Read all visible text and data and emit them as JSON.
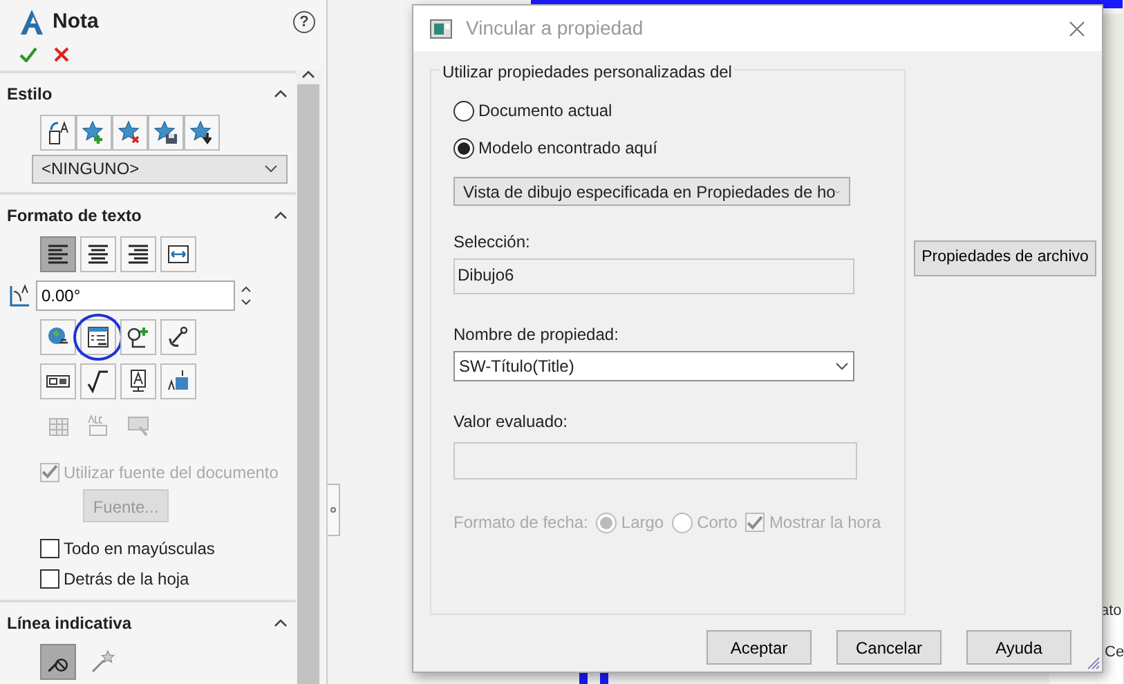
{
  "panel": {
    "title": "Nota",
    "help": "?",
    "sections": [
      {
        "kind": "style",
        "title": "Estilo",
        "expanded": true,
        "tools": [
          {
            "kind": "text-style"
          },
          {
            "kind": "star-add"
          },
          {
            "kind": "star-delete"
          },
          {
            "kind": "star-save"
          },
          {
            "kind": "star-load"
          }
        ],
        "select": "<NINGUNO>"
      },
      {
        "kind": "format",
        "title": "Formato de texto",
        "expanded": true,
        "align": [
          {
            "kind": "align-left",
            "selected": true
          },
          {
            "kind": "align-center",
            "selected": false
          },
          {
            "kind": "align-right",
            "selected": false
          },
          {
            "kind": "fit-text",
            "selected": false
          }
        ],
        "angle": "0.00°",
        "tool_rows": [
          [
            {
              "kind": "globe-link",
              "disabled": false,
              "circled": false
            },
            {
              "kind": "property-link",
              "disabled": false,
              "circled": true
            },
            {
              "kind": "balloon-add",
              "disabled": false,
              "circled": false
            },
            {
              "kind": "anchor",
              "disabled": false,
              "circled": false
            }
          ],
          [
            {
              "kind": "frame",
              "disabled": false,
              "circled": false
            },
            {
              "kind": "sqrt",
              "disabled": false,
              "circled": false
            },
            {
              "kind": "text-box",
              "disabled": false,
              "circled": false
            },
            {
              "kind": "stack",
              "disabled": false,
              "circled": false
            }
          ],
          [
            {
              "kind": "table",
              "disabled": true,
              "circled": false
            },
            {
              "kind": "abc-link",
              "disabled": true,
              "circled": false
            },
            {
              "kind": "hatch",
              "disabled": true,
              "circled": false
            }
          ]
        ],
        "doc_font": {
          "label": "Utilizar fuente del documento",
          "checked": true,
          "disabled": true
        },
        "font_button": {
          "label": "Fuente...",
          "disabled": true
        },
        "checks": [
          {
            "label": "Todo en mayúsculas",
            "checked": false
          },
          {
            "label": "Detrás de la hoja",
            "checked": false
          }
        ]
      },
      {
        "kind": "leader",
        "title": "Línea indicativa",
        "expanded": true,
        "leaders": [
          {
            "kind": "no-leader",
            "selected": true
          },
          {
            "kind": "star-leader",
            "selected": false
          }
        ]
      }
    ]
  },
  "background_texts": [
    "ato",
    "Ce"
  ],
  "dialog": {
    "title": "Vincular a propiedad",
    "group_title": "Utilizar propiedades personalizadas del",
    "sources": [
      {
        "label": "Documento actual",
        "selected": false
      },
      {
        "label": "Modelo encontrado aquí",
        "selected": true
      }
    ],
    "model_select": "Vista de dibujo especificada en Propiedades de ho",
    "selection_label": "Selección:",
    "selection_value": "Dibujo6",
    "file_props_button": "Propiedades de archivo",
    "property_label": "Nombre de propiedad:",
    "property_value": "SW-Título(Title)",
    "evaluated_label": "Valor evaluado:",
    "date": {
      "label": "Formato de fecha:",
      "disabled": true,
      "options": [
        {
          "label": "Largo",
          "selected": true
        },
        {
          "label": "Corto",
          "selected": false
        }
      ],
      "show_time": {
        "label": "Mostrar la hora",
        "checked": true
      }
    },
    "buttons": [
      "Aceptar",
      "Cancelar",
      "Ayuda"
    ]
  }
}
